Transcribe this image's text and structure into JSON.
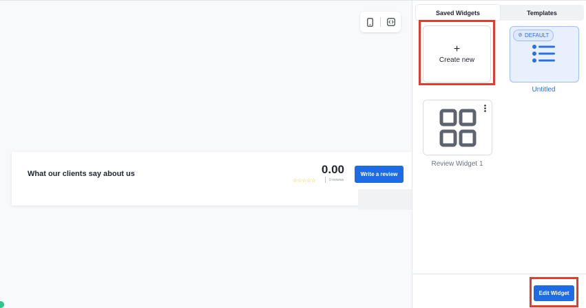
{
  "preview": {
    "device_toggle": {
      "mobile_icon": "mobile-icon",
      "code_icon": "code-icon"
    },
    "widget": {
      "title": "What our clients say about us",
      "score": "0.00",
      "stars": "☆☆☆☆☆",
      "reviews_count": "0 reviews",
      "write_button": "Write a review"
    }
  },
  "panel": {
    "tabs": [
      {
        "label": "Saved Widgets",
        "active": true
      },
      {
        "label": "Templates",
        "active": false
      }
    ],
    "create_card": {
      "plus": "+",
      "label": "Create new"
    },
    "default_widget": {
      "badge": "DEFAULT",
      "badge_icon": "gear-icon",
      "name": "Untitled"
    },
    "review_widget": {
      "name": "Review Widget 1",
      "menu_icon": "kebab-menu-icon"
    },
    "edit_button": "Edit Widget"
  },
  "colors": {
    "accent": "#1e6be6",
    "highlight": "#e33a2d",
    "star": "#f0b400"
  }
}
